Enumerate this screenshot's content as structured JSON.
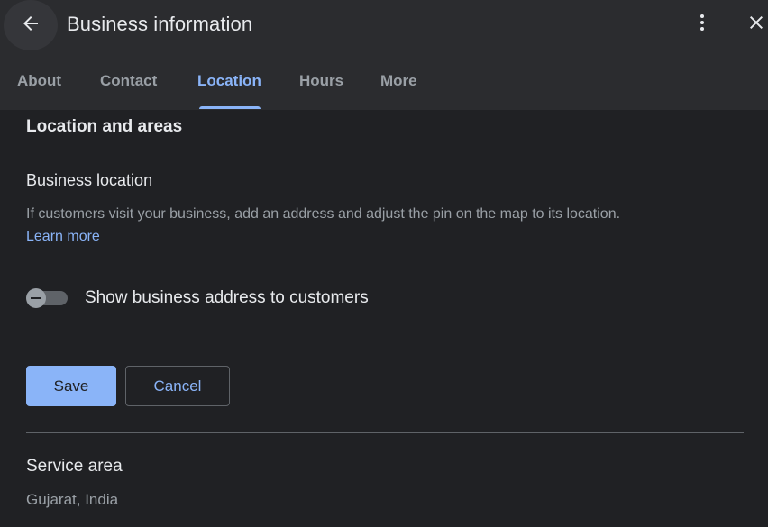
{
  "header": {
    "title": "Business information"
  },
  "tabs": [
    {
      "label": "About"
    },
    {
      "label": "Contact"
    },
    {
      "label": "Location"
    },
    {
      "label": "Hours"
    },
    {
      "label": "More"
    }
  ],
  "active_tab": "Location",
  "content": {
    "section_heading": "Location and areas",
    "business_location": {
      "heading": "Business location",
      "description": "If customers visit your business, add an address and adjust the pin on the map to its location.",
      "learn_more": "Learn more"
    },
    "toggle": {
      "label": "Show business address to customers",
      "state": "off"
    },
    "buttons": {
      "save": "Save",
      "cancel": "Cancel"
    },
    "service_area": {
      "heading": "Service area",
      "value": "Gujarat, India"
    }
  },
  "colors": {
    "background": "#202124",
    "header": "#2b2c2f",
    "accent": "#8ab4f8",
    "text_primary": "#e8eaed",
    "text_secondary": "#9aa0a6"
  },
  "icons": {
    "back": "arrow-left-icon",
    "more": "kebab-vertical-icon",
    "close": "close-icon"
  }
}
